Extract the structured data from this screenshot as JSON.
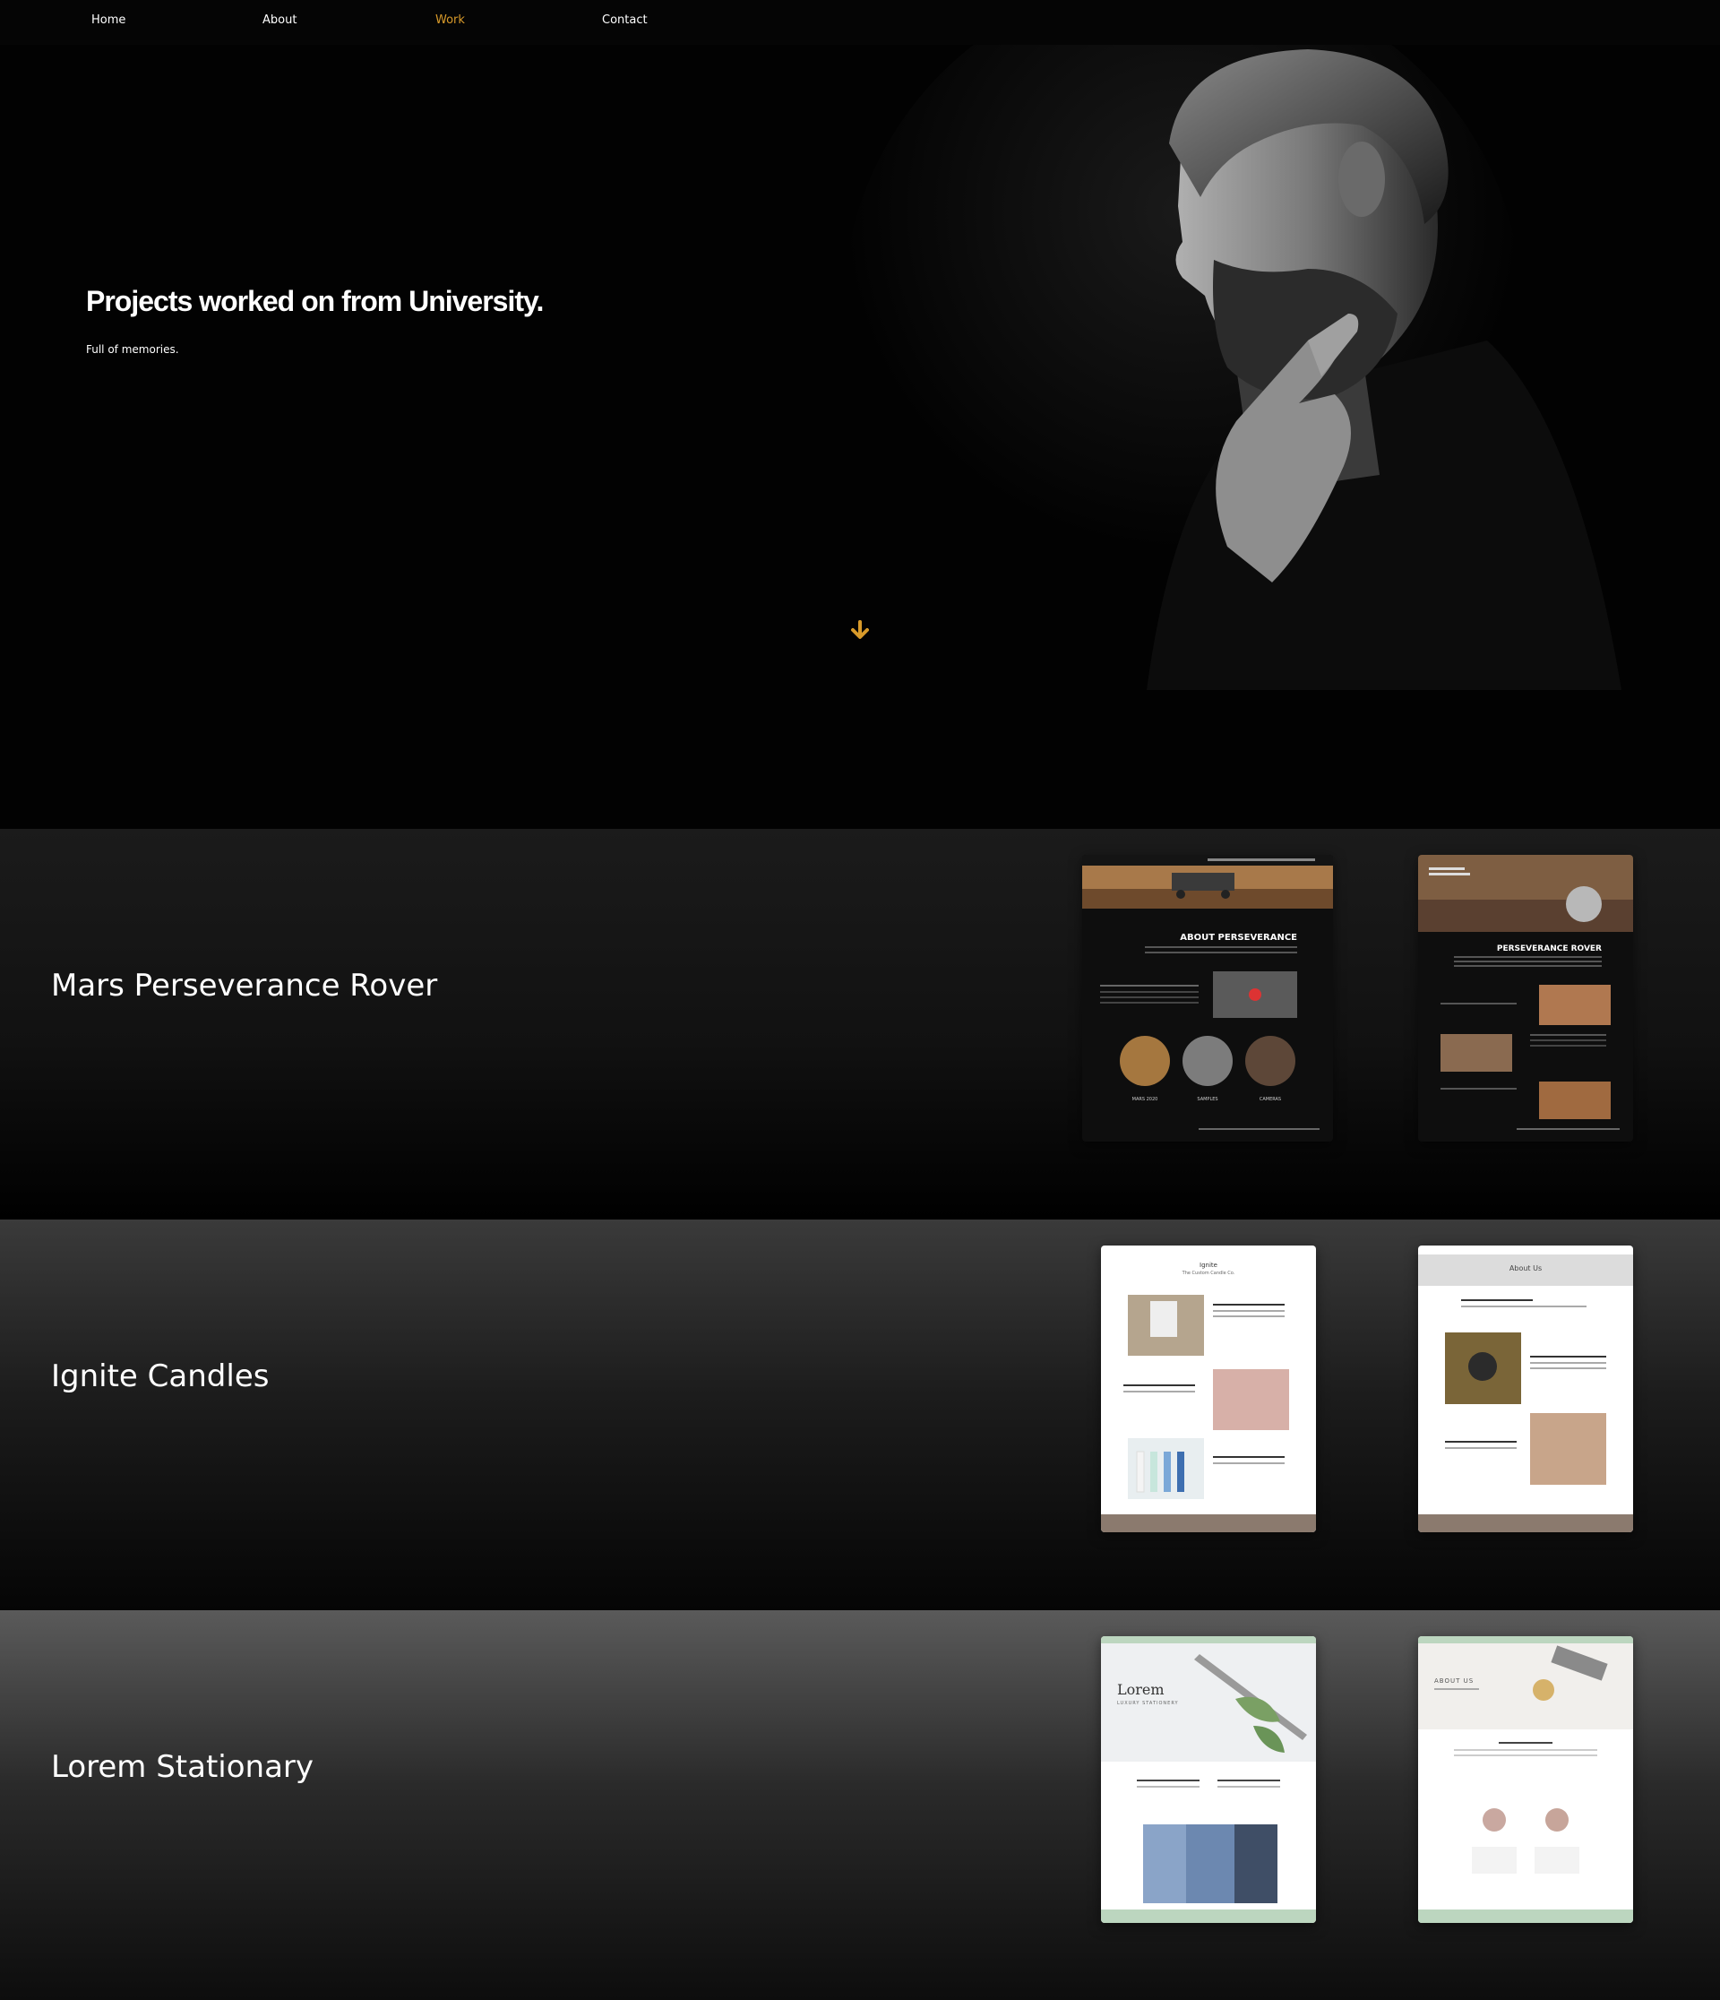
{
  "nav": {
    "items": [
      {
        "label": "Home"
      },
      {
        "label": "About"
      },
      {
        "label": "Work"
      },
      {
        "label": "Contact"
      }
    ],
    "active_color": "#d89a2a"
  },
  "hero": {
    "title": "Projects worked on from University.",
    "subtitle": "Full of memories.",
    "scroll_icon": "arrow-down-icon",
    "accent": "#d89a2a"
  },
  "projects": [
    {
      "title": "Mars Perseverance Rover",
      "thumbnails": [
        {
          "heading": "ABOUT PERSEVERANCE",
          "captions": [
            "MARS 2020",
            "SAMPLES",
            "CAMERAS"
          ]
        },
        {
          "heading": "PERSEVERANCE ROVER"
        }
      ]
    },
    {
      "title": "Ignite Candles",
      "thumbnails": [
        {
          "brand": "Ignite",
          "tagline": "The Custom Candle Co."
        },
        {
          "heading": "About Us"
        }
      ]
    },
    {
      "title": "Lorem Stationary",
      "thumbnails": [
        {
          "brand": "Lorem",
          "tagline": "LUXURY STATIONERY"
        },
        {
          "heading": "ABOUT US"
        }
      ]
    }
  ]
}
